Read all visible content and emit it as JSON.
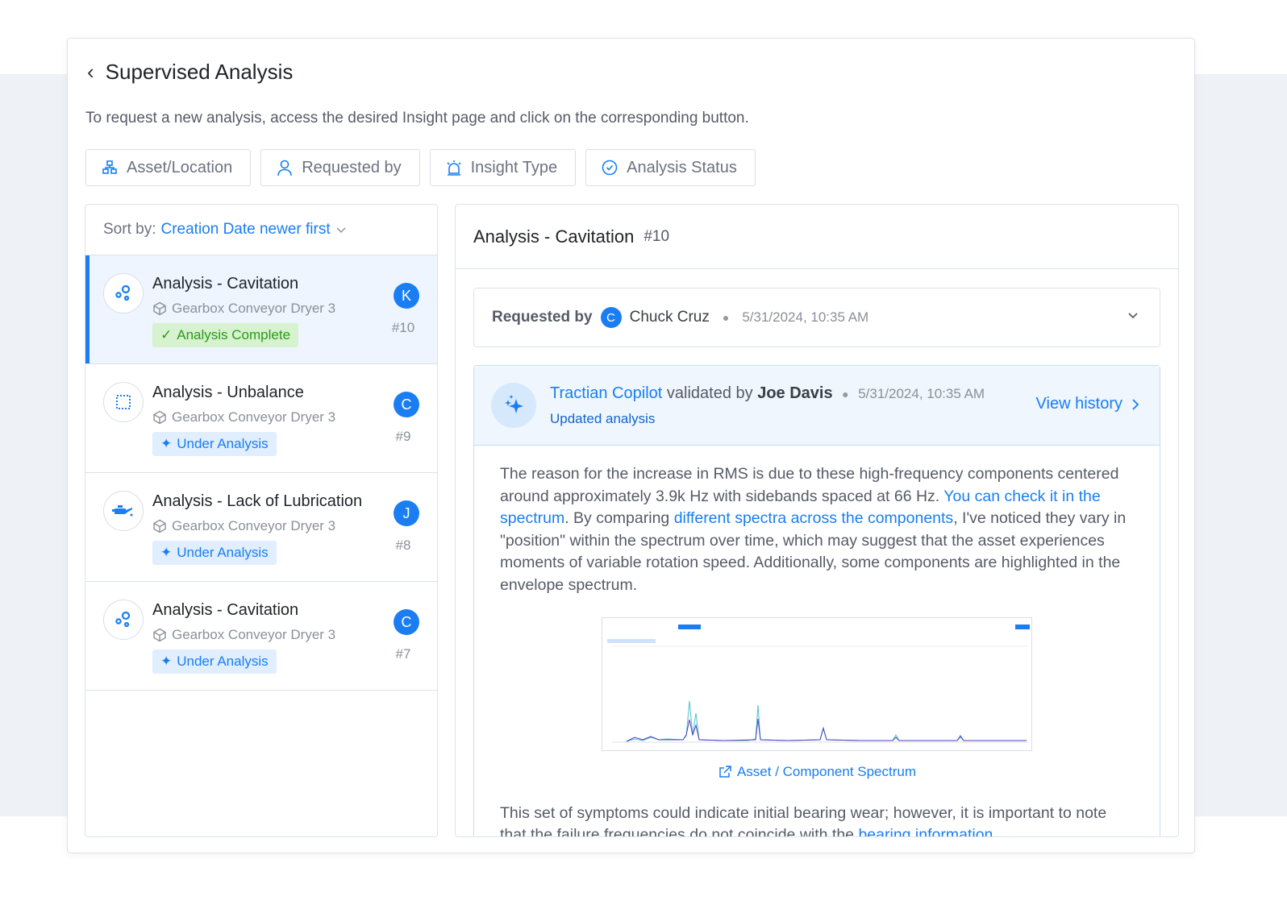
{
  "header": {
    "title": "Supervised Analysis",
    "description": "To request a new analysis, access the desired Insight page and click on the corresponding button."
  },
  "filters": [
    {
      "label": "Asset/Location",
      "icon": "hierarchy-icon"
    },
    {
      "label": "Requested by",
      "icon": "user-icon"
    },
    {
      "label": "Insight Type",
      "icon": "alarm-icon"
    },
    {
      "label": "Analysis Status",
      "icon": "check-circle-icon"
    }
  ],
  "sort": {
    "label": "Sort by:",
    "value": "Creation Date newer first"
  },
  "items": [
    {
      "title": "Analysis - Cavitation",
      "asset": "Gearbox Conveyor Dryer 3",
      "status": "Analysis Complete",
      "avatar": "K",
      "number": "#10",
      "icon": "bubbles-icon",
      "selected": true
    },
    {
      "title": "Analysis - Unbalance",
      "asset": "Gearbox Conveyor Dryer 3",
      "status": "Under Analysis",
      "avatar": "C",
      "number": "#9",
      "icon": "unbalance-icon"
    },
    {
      "title": "Analysis - Lack of Lubrication",
      "asset": "Gearbox Conveyor Dryer 3",
      "status": "Under Analysis",
      "avatar": "J",
      "number": "#8",
      "icon": "oil-can-icon"
    },
    {
      "title": "Analysis - Cavitation",
      "asset": "Gearbox Conveyor Dryer 3",
      "status": "Under Analysis",
      "avatar": "C",
      "number": "#7",
      "icon": "bubbles-icon"
    }
  ],
  "detail": {
    "title": "Analysis - Cavitation",
    "number": "#10",
    "requested": {
      "label": "Requested by",
      "avatar": "C",
      "name": "Chuck Cruz",
      "date": "5/31/2024, 10:35 AM"
    },
    "copilot": {
      "source": "Tractian Copilot",
      "validated_text": "validated by",
      "validator": "Joe Davis",
      "date": "5/31/2024, 10:35 AM",
      "subtitle": "Updated analysis",
      "history": "View history"
    },
    "p1": [
      "The reason for the increase in RMS is due to these high-frequency components centered around approximately 3.9k Hz with sidebands spaced at 66 Hz. ",
      "You can check it in the spectrum",
      ". By comparing ",
      "different spectra across the components",
      ", I've noticed they vary in \"position\" within the spectrum over time, which may suggest that the asset experiences moments of variable rotation speed. Additionally, some components are highlighted in the envelope spectrum."
    ],
    "image_caption": "Asset / Component Spectrum",
    "p2": [
      "This set of symptoms could indicate initial bearing wear; however, it is important to note that the failure frequencies do not coincide with the ",
      "bearing information"
    ]
  },
  "colors": {
    "accent": "#1a7ef2",
    "complete_bg": "#d6f2cf",
    "complete_text": "#2a9a1d",
    "under_bg": "#e0eefd"
  }
}
